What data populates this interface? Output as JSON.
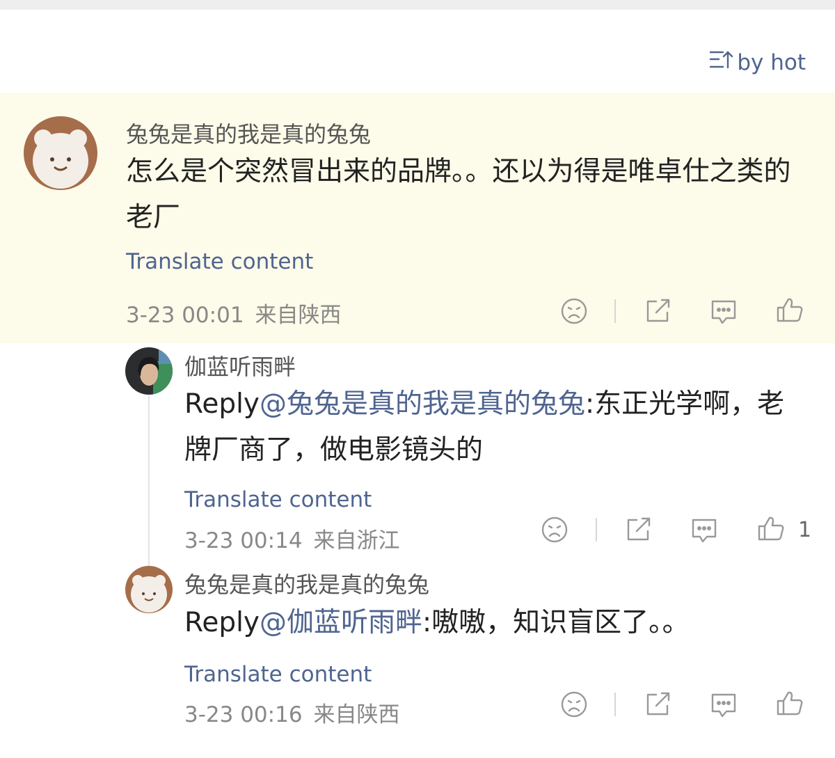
{
  "sort": {
    "label": "by hot"
  },
  "comments": [
    {
      "username": "兔兔是真的我是真的兔兔",
      "text": "怎么是个突然冒出来的品牌。。还以为得是唯卓仕之类的老厂",
      "translate": "Translate content",
      "time": "3-23 00:01",
      "location": "来自陕西",
      "likes": ""
    },
    {
      "username": "伽蓝听雨畔",
      "reply_prefix": "Reply",
      "mention": "@兔兔是真的我是真的兔兔",
      "text": ":东正光学啊，老牌厂商了，做电影镜头的",
      "translate": "Translate content",
      "time": "3-23 00:14",
      "location": "来自浙江",
      "likes": "1"
    },
    {
      "username": "兔兔是真的我是真的兔兔",
      "reply_prefix": "Reply",
      "mention": "@伽蓝听雨畔",
      "text": ":嗷嗷，知识盲区了。。",
      "translate": "Translate content",
      "time": "3-23 00:16",
      "location": "来自陕西",
      "likes": ""
    }
  ],
  "colors": {
    "accent": "#4f6490",
    "highlight": "#fdfbe9",
    "icon": "#999999"
  }
}
